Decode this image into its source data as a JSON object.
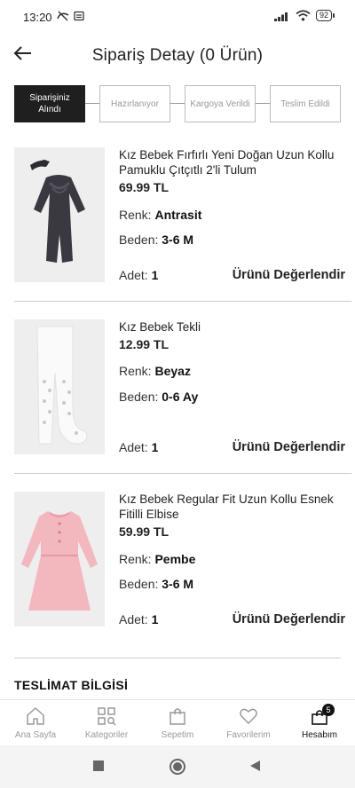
{
  "status_bar": {
    "time": "13:20",
    "battery": "92"
  },
  "header": {
    "title": "Sipariş Detay (0 Ürün)"
  },
  "steps": [
    {
      "label": "Siparişiniz Alındı",
      "active": true
    },
    {
      "label": "Hazırlanıyor",
      "active": false
    },
    {
      "label": "Kargoya Verildi",
      "active": false
    },
    {
      "label": "Teslim Edildi",
      "active": false
    }
  ],
  "labels": {
    "color": "Renk:",
    "size": "Beden:",
    "qty": "Adet:",
    "rate": "Ürünü Değerlendir"
  },
  "products": [
    {
      "name": "Kız Bebek Fırfırlı Yeni Doğan Uzun Kollu Pamuklu Çıtçıtlı 2'li Tulum",
      "price": "69.99 TL",
      "color": "Antrasit",
      "size": "3-6 M",
      "qty": "1"
    },
    {
      "name": "Kız Bebek Tekli",
      "price": "12.99 TL",
      "color": "Beyaz",
      "size": "0-6 Ay",
      "qty": "1"
    },
    {
      "name": "Kız Bebek Regular Fit Uzun Kollu Esnek Fitilli Elbise",
      "price": "59.99 TL",
      "color": "Pembe",
      "size": "3-6 M",
      "qty": "1"
    }
  ],
  "delivery": {
    "title": "TESLİMAT BİLGİSİ"
  },
  "bottom_nav": [
    {
      "label": "Ana Sayfa",
      "icon": "home-icon"
    },
    {
      "label": "Kategoriler",
      "icon": "categories-icon"
    },
    {
      "label": "Sepetim",
      "icon": "bag-icon"
    },
    {
      "label": "Favorilerim",
      "icon": "heart-icon"
    },
    {
      "label": "Hesabım",
      "icon": "account-icon",
      "badge": "5",
      "active": true
    }
  ],
  "colors": {
    "accent": "#1f1f1f",
    "muted": "#999999",
    "divider": "#cccccc"
  }
}
